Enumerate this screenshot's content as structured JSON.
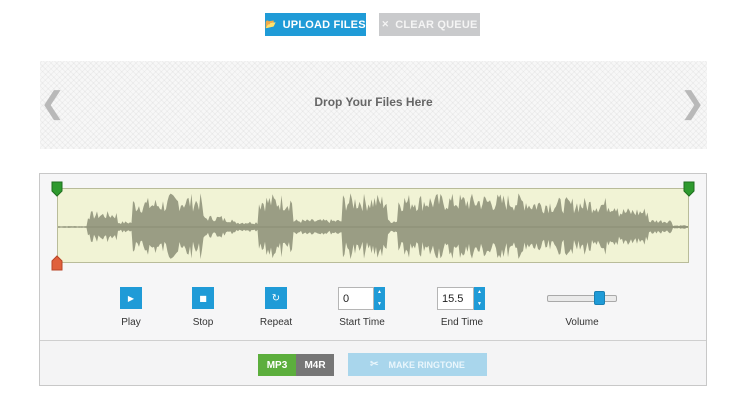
{
  "toolbar": {
    "upload_label": "UPLOAD FILES",
    "upload_icon": "folder-icon",
    "clear_label": "CLEAR QUEUE",
    "clear_icon": "close-icon"
  },
  "dropzone": {
    "text": "Drop Your Files Here",
    "prev_icon": "chevron-left-icon",
    "next_icon": "chevron-right-icon"
  },
  "editor": {
    "controls": {
      "play_label": "Play",
      "stop_label": "Stop",
      "repeat_label": "Repeat",
      "start_time_label": "Start Time",
      "start_time_value": "0",
      "end_time_label": "End Time",
      "end_time_value": "15.5",
      "volume_label": "Volume",
      "volume_level": 0.8
    },
    "selection": {
      "start_fraction": 0.0,
      "end_fraction": 1.0
    },
    "colors": {
      "accent": "#1f9bd7",
      "waveform": "#9a9d84",
      "wave_bg": "#f1f3d5",
      "marker_green": "#2e9a2e",
      "marker_red": "#e0603c"
    }
  },
  "output": {
    "formats": [
      "MP3",
      "M4R"
    ],
    "selected_format": "MP3",
    "make_label": "MAKE RINGTONE",
    "make_icon": "scissors-icon"
  }
}
